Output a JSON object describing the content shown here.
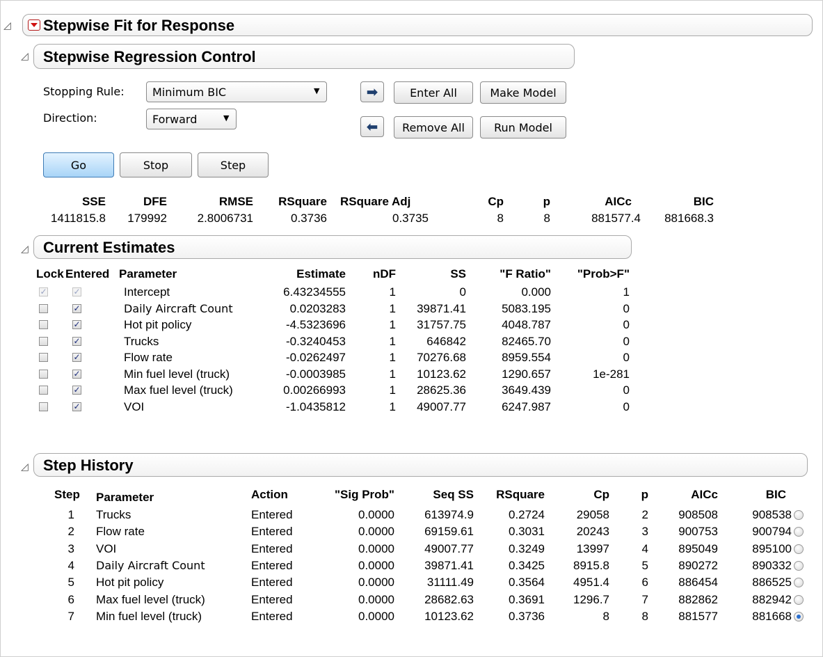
{
  "title": "Stepwise Fit for Response",
  "control": {
    "title": "Stepwise Regression Control",
    "stopping_rule_label": "Stopping Rule:",
    "stopping_rule_value": "Minimum BIC",
    "direction_label": "Direction:",
    "direction_value": "Forward",
    "enter_all": "Enter All",
    "make_model": "Make Model",
    "remove_all": "Remove All",
    "run_model": "Run Model",
    "go": "Go",
    "stop": "Stop",
    "step": "Step",
    "icons": {
      "enter": "right-arrow-icon",
      "remove": "left-arrow-icon",
      "menu": "red-triangle-menu-icon"
    }
  },
  "summary": {
    "headers": [
      "SSE",
      "DFE",
      "RMSE",
      "RSquare",
      "RSquare Adj",
      "Cp",
      "p",
      "AICc",
      "BIC"
    ],
    "values": [
      "1411815.8",
      "179992",
      "2.8006731",
      "0.3736",
      "0.3735",
      "8",
      "8",
      "881577.4",
      "881668.3"
    ]
  },
  "estimates": {
    "title": "Current Estimates",
    "headers": [
      "Lock",
      "Entered",
      "Parameter",
      "Estimate",
      "nDF",
      "SS",
      "\"F Ratio\"",
      "\"Prob>F\""
    ],
    "rows": [
      {
        "lock": true,
        "entered": true,
        "locked": true,
        "parameter": "Intercept",
        "estimate": "6.43234555",
        "ndf": "1",
        "ss": "0",
        "f": "0.000",
        "prob": "1"
      },
      {
        "lock": false,
        "entered": true,
        "locked": false,
        "parameter": "Daily Aircraft Count",
        "estimate": "0.0203283",
        "ndf": "1",
        "ss": "39871.41",
        "f": "5083.195",
        "prob": "0"
      },
      {
        "lock": false,
        "entered": true,
        "locked": false,
        "parameter": "Hot pit policy",
        "estimate": "-4.5323696",
        "ndf": "1",
        "ss": "31757.75",
        "f": "4048.787",
        "prob": "0"
      },
      {
        "lock": false,
        "entered": true,
        "locked": false,
        "parameter": "Trucks",
        "estimate": "-0.3240453",
        "ndf": "1",
        "ss": "646842",
        "f": "82465.70",
        "prob": "0"
      },
      {
        "lock": false,
        "entered": true,
        "locked": false,
        "parameter": "Flow rate",
        "estimate": "-0.0262497",
        "ndf": "1",
        "ss": "70276.68",
        "f": "8959.554",
        "prob": "0"
      },
      {
        "lock": false,
        "entered": true,
        "locked": false,
        "parameter": "Min fuel level (truck)",
        "estimate": "-0.0003985",
        "ndf": "1",
        "ss": "10123.62",
        "f": "1290.657",
        "prob": "1e-281"
      },
      {
        "lock": false,
        "entered": true,
        "locked": false,
        "parameter": "Max fuel level (truck)",
        "estimate": "0.00266993",
        "ndf": "1",
        "ss": "28625.36",
        "f": "3649.439",
        "prob": "0"
      },
      {
        "lock": false,
        "entered": true,
        "locked": false,
        "parameter": "VOI",
        "estimate": "-1.0435812",
        "ndf": "1",
        "ss": "49007.77",
        "f": "6247.987",
        "prob": "0"
      }
    ]
  },
  "history": {
    "title": "Step History",
    "headers": [
      "Step",
      "Parameter",
      "Action",
      "\"Sig Prob\"",
      "Seq SS",
      "RSquare",
      "Cp",
      "p",
      "AICc",
      "BIC"
    ],
    "rows": [
      {
        "step": "1",
        "parameter": "Trucks",
        "action": "Entered",
        "sig": "0.0000",
        "seqss": "613974.9",
        "rsq": "0.2724",
        "cp": "29058",
        "p": "2",
        "aicc": "908508",
        "bic": "908538",
        "selected": false
      },
      {
        "step": "2",
        "parameter": "Flow rate",
        "action": "Entered",
        "sig": "0.0000",
        "seqss": "69159.61",
        "rsq": "0.3031",
        "cp": "20243",
        "p": "3",
        "aicc": "900753",
        "bic": "900794",
        "selected": false
      },
      {
        "step": "3",
        "parameter": "VOI",
        "action": "Entered",
        "sig": "0.0000",
        "seqss": "49007.77",
        "rsq": "0.3249",
        "cp": "13997",
        "p": "4",
        "aicc": "895049",
        "bic": "895100",
        "selected": false
      },
      {
        "step": "4",
        "parameter": "Daily Aircraft Count",
        "action": "Entered",
        "sig": "0.0000",
        "seqss": "39871.41",
        "rsq": "0.3425",
        "cp": "8915.8",
        "p": "5",
        "aicc": "890272",
        "bic": "890332",
        "selected": false
      },
      {
        "step": "5",
        "parameter": "Hot pit policy",
        "action": "Entered",
        "sig": "0.0000",
        "seqss": "31111.49",
        "rsq": "0.3564",
        "cp": "4951.4",
        "p": "6",
        "aicc": "886454",
        "bic": "886525",
        "selected": false
      },
      {
        "step": "6",
        "parameter": "Max fuel level (truck)",
        "action": "Entered",
        "sig": "0.0000",
        "seqss": "28682.63",
        "rsq": "0.3691",
        "cp": "1296.7",
        "p": "7",
        "aicc": "882862",
        "bic": "882942",
        "selected": false
      },
      {
        "step": "7",
        "parameter": "Min fuel level (truck)",
        "action": "Entered",
        "sig": "0.0000",
        "seqss": "10123.62",
        "rsq": "0.3736",
        "cp": "8",
        "p": "8",
        "aicc": "881577",
        "bic": "881668",
        "selected": true
      }
    ]
  }
}
